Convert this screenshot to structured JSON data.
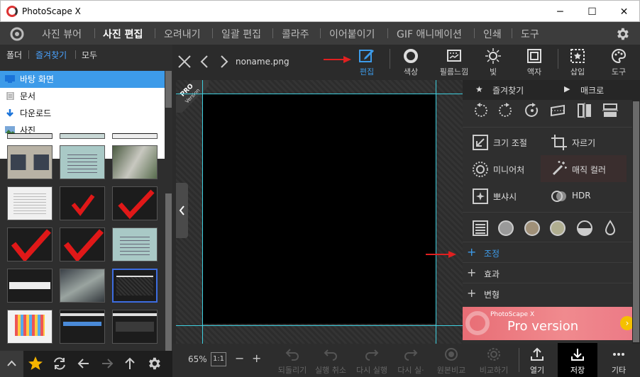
{
  "window": {
    "title": "PhotoScape X",
    "minimize": "─",
    "maximize": "☐",
    "close": "✕"
  },
  "menu": {
    "items": [
      "사진 뷰어",
      "사진 편집",
      "오려내기",
      "일괄 편집",
      "콜라주",
      "이어붙이기",
      "GIF 애니메이션",
      "인쇄",
      "도구"
    ],
    "active_index": 1
  },
  "left_panel": {
    "tabs": [
      "폴더",
      "즐겨찾기",
      "모두"
    ],
    "active_tab_index": 1,
    "tree": [
      {
        "label": "바탕 화면",
        "icon": "desktop-icon",
        "selected": true
      },
      {
        "label": "문서",
        "icon": "document-icon",
        "selected": false
      },
      {
        "label": "다운로드",
        "icon": "download-icon",
        "selected": false
      },
      {
        "label": "사진",
        "icon": "pictures-icon",
        "selected": false
      }
    ]
  },
  "toolbar": {
    "filename": "noname.png",
    "tools": [
      "편집",
      "색상",
      "필름느낌",
      "빛",
      "액자",
      "삽입",
      "도구"
    ],
    "active_tool_index": 0
  },
  "canvas": {
    "pro_badge_line1": "PRO",
    "pro_badge_line2": "Version"
  },
  "right_panel": {
    "favorites_label": "즐겨찾기",
    "macro_label": "매크로",
    "tools": [
      {
        "label": "크기 조절",
        "icon": "resize-icon"
      },
      {
        "label": "자르기",
        "icon": "crop-icon"
      },
      {
        "label": "미니어처",
        "icon": "miniature-icon"
      },
      {
        "label": "매직 컬러",
        "icon": "magic-wand-icon"
      },
      {
        "label": "뽀샤시",
        "icon": "sparkle-icon"
      },
      {
        "label": "HDR",
        "icon": "hdr-icon"
      }
    ],
    "sections": [
      {
        "label": "조정",
        "active": true
      },
      {
        "label": "효과",
        "active": false
      },
      {
        "label": "변형",
        "active": false
      }
    ],
    "ad": {
      "small": "PhotoScape X",
      "big": "Pro version"
    }
  },
  "bottom": {
    "zoom": "65%",
    "fit": "1:1",
    "minus": "−",
    "plus": "+",
    "actions": [
      "되돌리기",
      "실행 취소",
      "다시 실행",
      "다시 실·",
      "원본비교",
      "비교하기"
    ],
    "open_label": "열기",
    "save_label": "저장",
    "more_label": "기타"
  },
  "colors": {
    "accent": "#3d9be9",
    "arrow": "#e02020",
    "cyan_guide": "#3fd0e0"
  }
}
